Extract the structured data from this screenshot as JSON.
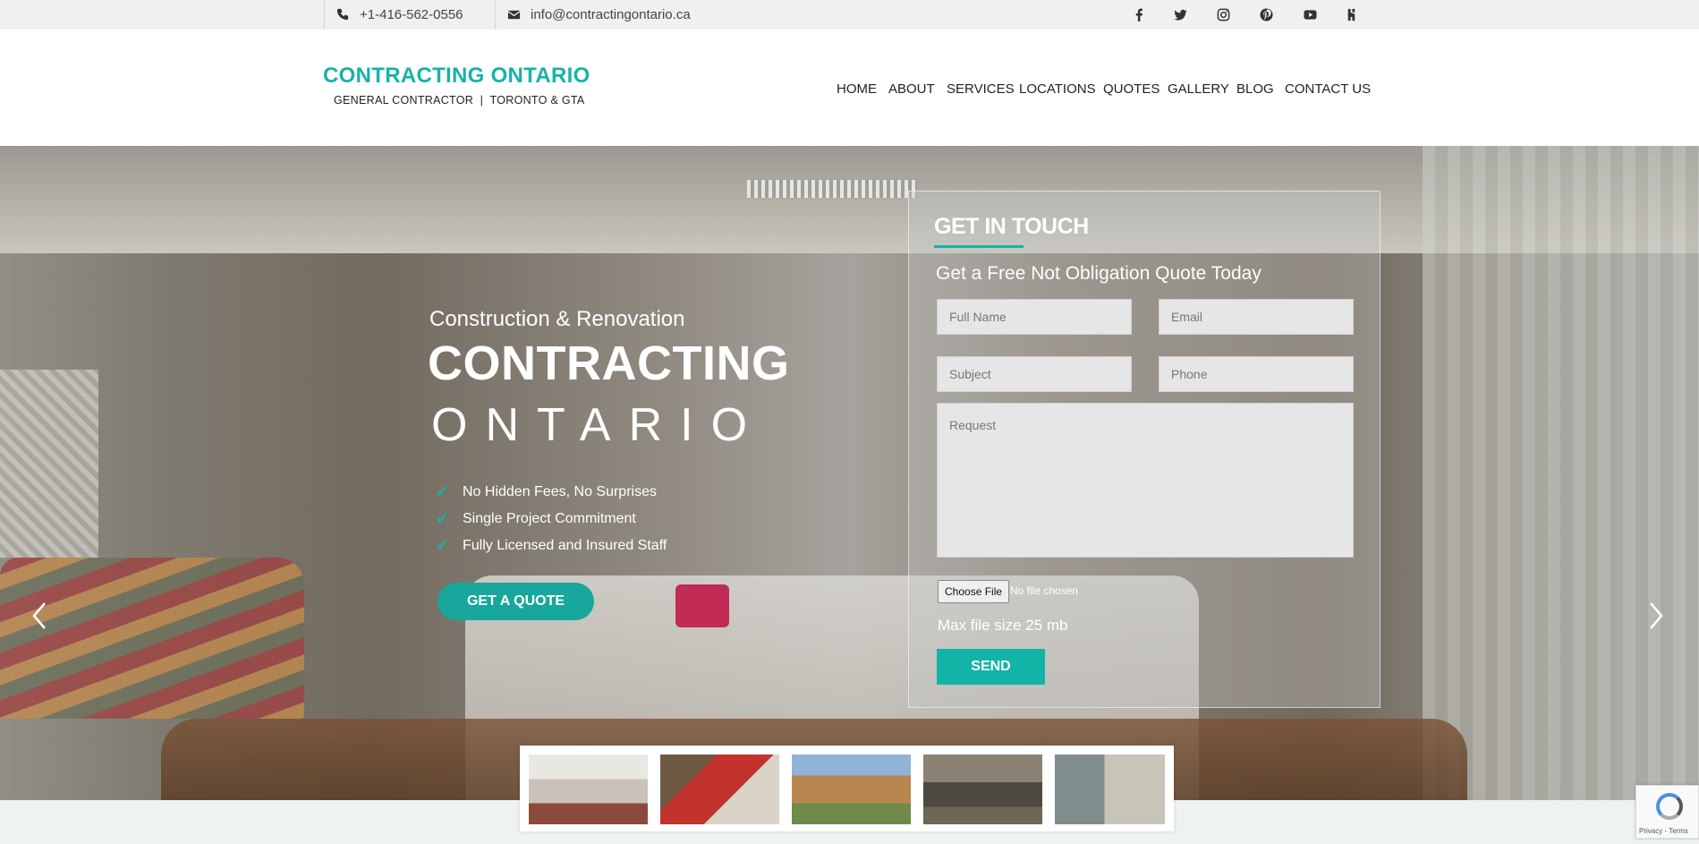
{
  "topbar": {
    "phone": "+1-416-562-0556",
    "email": "info@contractingontario.ca",
    "social_icons": [
      "facebook-icon",
      "twitter-icon",
      "instagram-icon",
      "pinterest-icon",
      "youtube-icon",
      "houzz-icon"
    ]
  },
  "header": {
    "logo_title": "CONTRACTING ONTARIO",
    "logo_subtitle": "GENERAL CONTRACTOR  |  TORONTO & GTA",
    "nav": [
      "HOME",
      "ABOUT",
      "SERVICES",
      "LOCATIONS",
      "QUOTES",
      "GALLERY",
      "BLOG",
      "CONTACT US"
    ]
  },
  "hero": {
    "subheading": "Construction & Renovation",
    "title_line1": "CONTRACTING",
    "title_line2": "ONTARIO",
    "checks": [
      "No Hidden Fees, No Surprises",
      "Single Project Commitment",
      "Fully Licensed and Insured Staff"
    ],
    "cta": "GET A QUOTE"
  },
  "form": {
    "title": "GET IN TOUCH",
    "tagline": "Get a Free Not Obligation Quote Today",
    "placeholders": {
      "full_name": "Full Name",
      "email": "Email",
      "subject": "Subject",
      "phone": "Phone",
      "request": "Request"
    },
    "choose_file": "Choose File",
    "no_file": "No file chosen",
    "max_size": "Max file size 25 mb",
    "send": "SEND"
  },
  "recaptcha": {
    "terms": "Privacy - Terms"
  },
  "colors": {
    "accent": "#17b3a8",
    "button": "#17a79c"
  }
}
